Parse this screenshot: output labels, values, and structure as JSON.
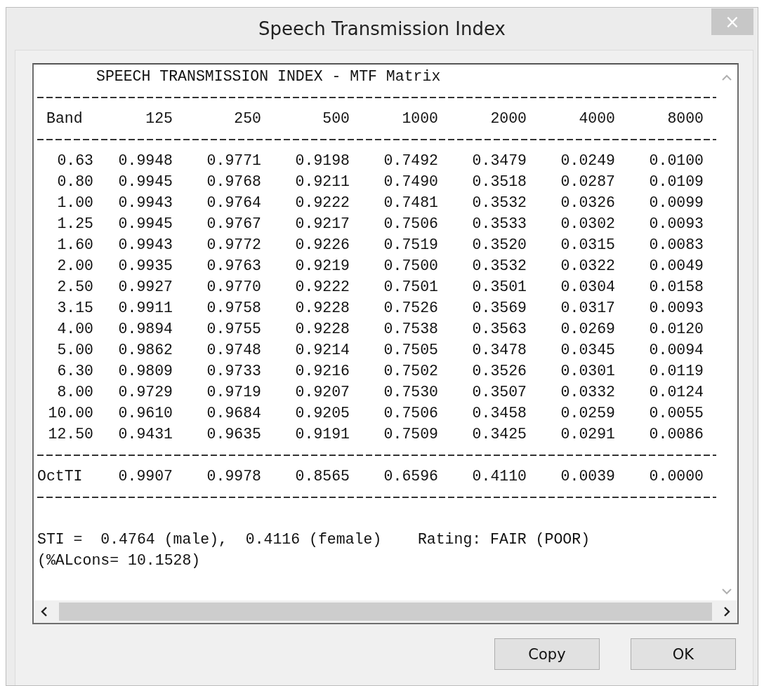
{
  "window": {
    "title": "Speech Transmission Index",
    "close": "×"
  },
  "report": {
    "heading": "SPEECH TRANSMISSION INDEX - MTF Matrix",
    "columns": [
      "Band",
      "125",
      "250",
      "500",
      "1000",
      "2000",
      "4000",
      "8000"
    ],
    "rows": [
      {
        "band": "0.63",
        "values": [
          "0.9948",
          "0.9771",
          "0.9198",
          "0.7492",
          "0.3479",
          "0.0249",
          "0.0100"
        ]
      },
      {
        "band": "0.80",
        "values": [
          "0.9945",
          "0.9768",
          "0.9211",
          "0.7490",
          "0.3518",
          "0.0287",
          "0.0109"
        ]
      },
      {
        "band": "1.00",
        "values": [
          "0.9943",
          "0.9764",
          "0.9222",
          "0.7481",
          "0.3532",
          "0.0326",
          "0.0099"
        ]
      },
      {
        "band": "1.25",
        "values": [
          "0.9945",
          "0.9767",
          "0.9217",
          "0.7506",
          "0.3533",
          "0.0302",
          "0.0093"
        ]
      },
      {
        "band": "1.60",
        "values": [
          "0.9943",
          "0.9772",
          "0.9226",
          "0.7519",
          "0.3520",
          "0.0315",
          "0.0083"
        ]
      },
      {
        "band": "2.00",
        "values": [
          "0.9935",
          "0.9763",
          "0.9219",
          "0.7500",
          "0.3532",
          "0.0322",
          "0.0049"
        ]
      },
      {
        "band": "2.50",
        "values": [
          "0.9927",
          "0.9770",
          "0.9222",
          "0.7501",
          "0.3501",
          "0.0304",
          "0.0158"
        ]
      },
      {
        "band": "3.15",
        "values": [
          "0.9911",
          "0.9758",
          "0.9228",
          "0.7526",
          "0.3569",
          "0.0317",
          "0.0093"
        ]
      },
      {
        "band": "4.00",
        "values": [
          "0.9894",
          "0.9755",
          "0.9228",
          "0.7538",
          "0.3563",
          "0.0269",
          "0.0120"
        ]
      },
      {
        "band": "5.00",
        "values": [
          "0.9862",
          "0.9748",
          "0.9214",
          "0.7505",
          "0.3478",
          "0.0345",
          "0.0094"
        ]
      },
      {
        "band": "6.30",
        "values": [
          "0.9809",
          "0.9733",
          "0.9216",
          "0.7502",
          "0.3526",
          "0.0301",
          "0.0119"
        ]
      },
      {
        "band": "8.00",
        "values": [
          "0.9729",
          "0.9719",
          "0.9207",
          "0.7530",
          "0.3507",
          "0.0332",
          "0.0124"
        ]
      },
      {
        "band": "10.00",
        "values": [
          "0.9610",
          "0.9684",
          "0.9205",
          "0.7506",
          "0.3458",
          "0.0259",
          "0.0055"
        ]
      },
      {
        "band": "12.50",
        "values": [
          "0.9431",
          "0.9635",
          "0.9191",
          "0.7509",
          "0.3425",
          "0.0291",
          "0.0086"
        ]
      }
    ],
    "total": {
      "band": "OctTI",
      "values": [
        "0.9907",
        "0.9978",
        "0.8565",
        "0.6596",
        "0.4110",
        "0.0039",
        "0.0000"
      ]
    },
    "summary": [
      "STI =  0.4764 (male),  0.4116 (female)    Rating: FAIR (POOR)",
      "(%ALcons= 10.1528)"
    ]
  },
  "buttons": [
    "Copy",
    "OK"
  ]
}
